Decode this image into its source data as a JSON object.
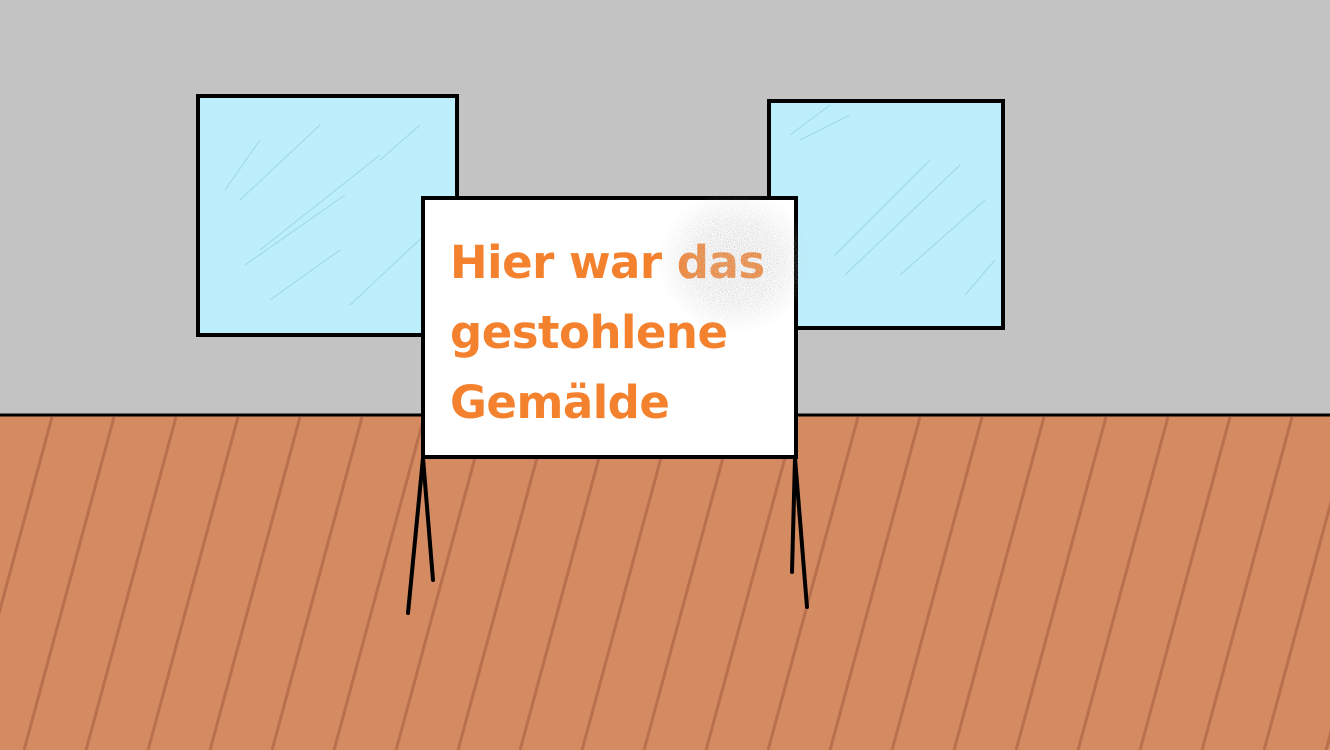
{
  "scene": {
    "colors": {
      "wall": "#c3c3c3",
      "floor": "#d48b62",
      "floor_lines": "#b9704d",
      "window_glass": "#bdeefc",
      "window_scratch": "#8fcfe0",
      "outline": "#000000",
      "sign_background": "#ffffff",
      "sign_text": "#f4812d",
      "smudge": "#9d9d9d"
    },
    "objects": [
      "window-left",
      "window-right",
      "floor",
      "sign-board",
      "easel-legs",
      "gray-smudge"
    ]
  },
  "sign": {
    "line1": "Hier war das",
    "line2": "gestohlene",
    "line3": "Gemälde"
  }
}
